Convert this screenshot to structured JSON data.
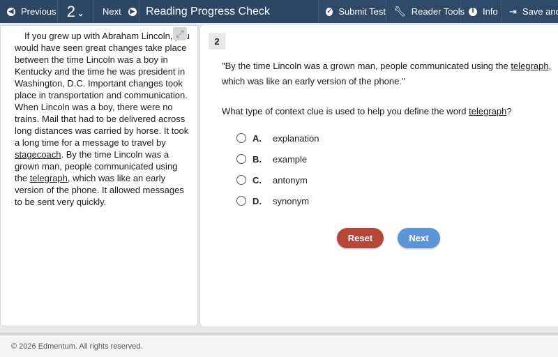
{
  "toolbar": {
    "previous_label": "Previous",
    "question_number": "2",
    "next_label": "Next",
    "title": "Reading Progress Check",
    "submit_label": "Submit Test",
    "reader_tools_label": "Reader Tools",
    "info_label": "Info",
    "save_label": "Save and"
  },
  "passage": {
    "part1": "If you grew up with Abraham Lincoln, you would have seen great changes take place between the time Lincoln was a boy in Kentucky and the time he was president in Washington, D.C. Important changes took place in transportation and communication. When Lincoln was a boy, there were no trains. Mail that had to be delivered across long distances was carried by horse. It took a long time for a message to travel by ",
    "word1": "stagecoach",
    "part2": ". By the time Lincoln was a grown man, people communicated using the ",
    "word2": "telegraph",
    "part3": ", which was like an early version of the phone. It allowed messages to be sent very quickly."
  },
  "question": {
    "number": "2",
    "quote_part1": "\"By the time Lincoln was a grown man, people communicated using the ",
    "quote_word": "telegraph",
    "quote_part2": ", which was like an early version of the phone.\"",
    "prompt_part1": "What type of context clue is used to help you define the word ",
    "prompt_word": "telegraph",
    "prompt_part2": "?",
    "options": [
      {
        "letter": "A.",
        "text": "explanation"
      },
      {
        "letter": "B.",
        "text": "example"
      },
      {
        "letter": "C.",
        "text": "antonym"
      },
      {
        "letter": "D.",
        "text": "synonym"
      }
    ],
    "reset_label": "Reset",
    "next_label": "Next"
  },
  "footer": {
    "copyright": "© 2026 Edmentum. All rights reserved."
  },
  "colors": {
    "toolbar_bg": "#2b4763",
    "reset_button": "#b5473a",
    "next_button": "#5d95d8"
  }
}
